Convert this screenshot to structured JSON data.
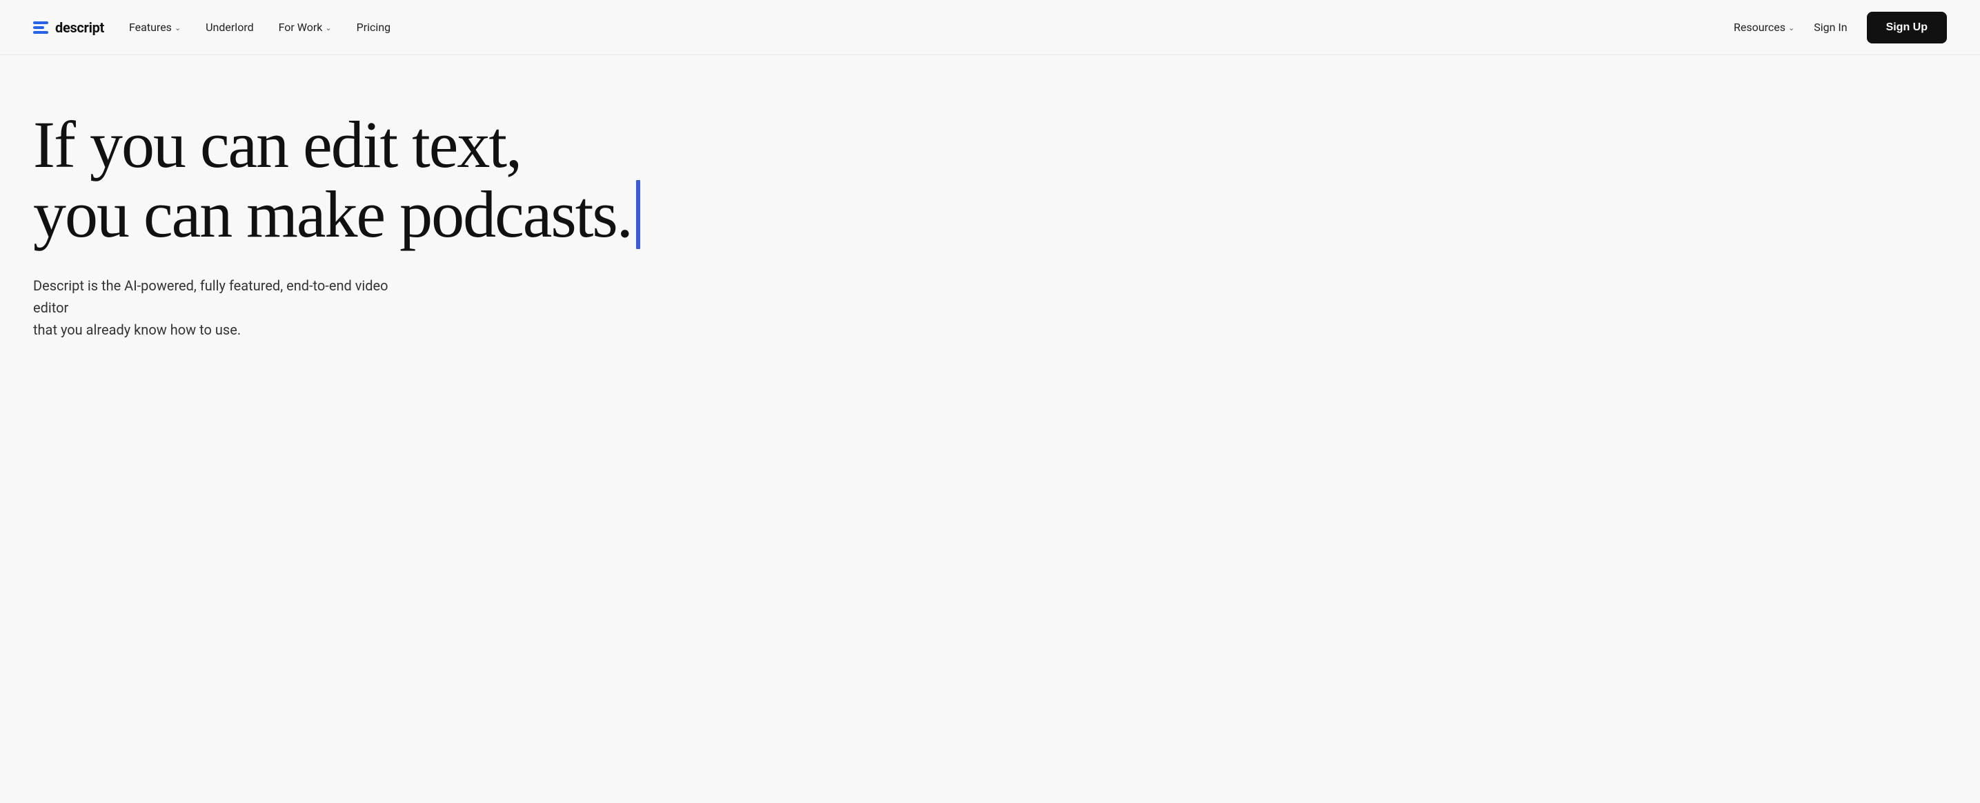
{
  "nav": {
    "logo_text": "descript",
    "links": [
      {
        "label": "Features",
        "has_chevron": true
      },
      {
        "label": "Underlord",
        "has_chevron": false
      },
      {
        "label": "For Work",
        "has_chevron": true
      },
      {
        "label": "Pricing",
        "has_chevron": false
      }
    ],
    "right_links": [
      {
        "label": "Resources",
        "has_chevron": true
      },
      {
        "label": "Sign In",
        "has_chevron": false
      }
    ],
    "signup_label": "Sign Up"
  },
  "hero": {
    "headline_line1": "If you can edit text,",
    "headline_line2": "you can make podcasts.",
    "subtext_line1": "Descript is the AI-powered, fully featured, end-to-end video editor",
    "subtext_line2": "that you already know how to use."
  },
  "colors": {
    "cursor": "#3b5bdb",
    "logo_blue": "#2563eb",
    "signup_bg": "#111111"
  }
}
